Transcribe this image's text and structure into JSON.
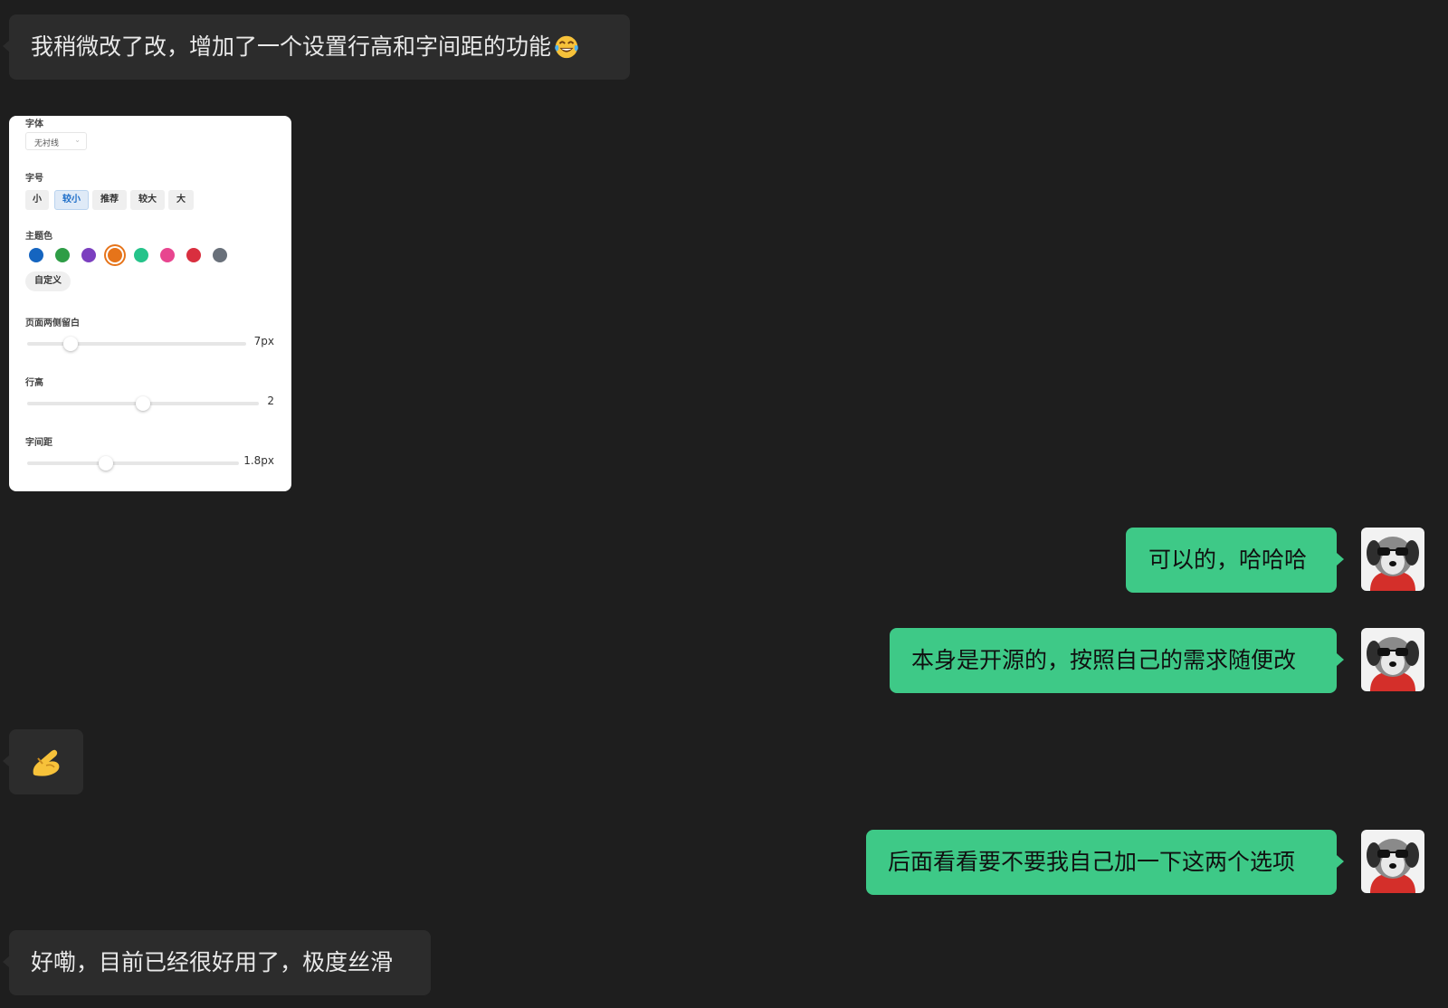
{
  "messages": [
    {
      "side": "left",
      "text": "我稍微改了改，增加了一个设置行高和字间距的功能",
      "emoji": "tears-of-joy"
    },
    {
      "side": "right",
      "text": "可以的，哈哈哈"
    },
    {
      "side": "right",
      "text": "本身是开源的，按照自己的需求随便改"
    },
    {
      "side": "left",
      "emoji": "pinching-hand"
    },
    {
      "side": "right",
      "text": "后面看看要不要我自己加一下这两个选项"
    },
    {
      "side": "left",
      "text": "好嘞，目前已经很好用了，极度丝滑"
    }
  ],
  "settings_panel": {
    "font_label": "字体",
    "font_value": "无衬线",
    "size_label": "字号",
    "size_options": [
      "小",
      "较小",
      "推荐",
      "较大",
      "大"
    ],
    "size_selected": "较小",
    "theme_label": "主题色",
    "theme_colors": [
      "#1565c0",
      "#2e9d46",
      "#7b3fbf",
      "#e6741a",
      "#25c38a",
      "#e8458f",
      "#d92f3f",
      "#69707a"
    ],
    "theme_selected": "#e6741a",
    "custom_label": "自定义",
    "margin_label": "页面两侧留白",
    "margin_value": "7px",
    "margin_level": 0.2,
    "line_height_label": "行高",
    "line_height_value": "2",
    "line_height_level": 0.5,
    "letter_spacing_label": "字间距",
    "letter_spacing_value": "1.8px",
    "letter_spacing_level": 0.37
  },
  "colors": {
    "background": "#1e1e1e",
    "left_bubble": "#2c2c2c",
    "right_bubble": "#3ec987"
  }
}
